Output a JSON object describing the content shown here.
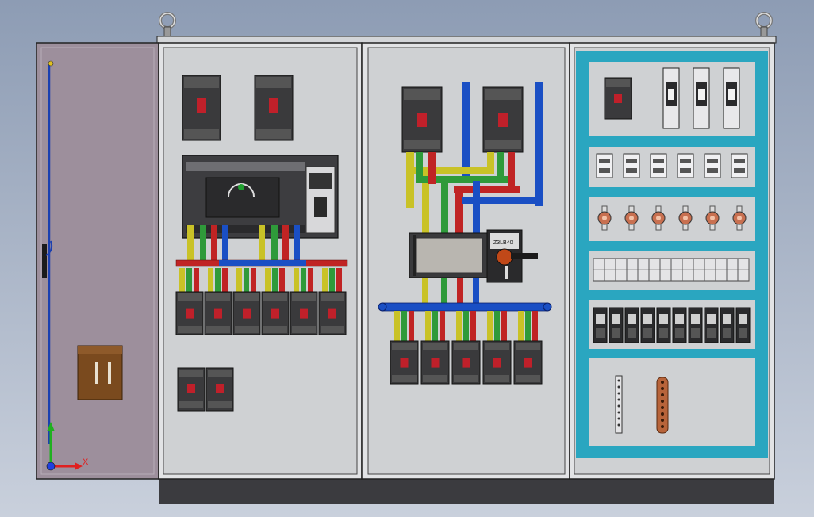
{
  "scene": {
    "background_top": "#8d9cb4",
    "background_bottom": "#c9d0dc",
    "door_color": "#9d8f9c",
    "panel_color": "#cfd1d3",
    "frame_color": "#2a2a2a",
    "plinth_color": "#3b3b3f",
    "din_rail_color": "#2aa6c0",
    "busbar_colors": {
      "phase_l1": "#c9c227",
      "phase_l2": "#2f9a3a",
      "phase_l3": "#c02424",
      "neutral": "#1a4fc4"
    }
  },
  "triad": {
    "x_label": "X",
    "x_color": "#e02020",
    "y_color": "#20b020",
    "z_color": "#2040e0"
  },
  "sections": {
    "left_panel": {
      "top_breakers": 2,
      "feeder_breakers": 6,
      "small_breakers": 2
    },
    "middle_panel": {
      "incoming_breakers": 2,
      "feeder_breakers": 5,
      "switch_tag": "Z3LB40"
    },
    "right_panel": {
      "fuse_holders": 3,
      "relays": 6,
      "indicator_lamps": 6,
      "terminal_blocks": 10
    }
  }
}
